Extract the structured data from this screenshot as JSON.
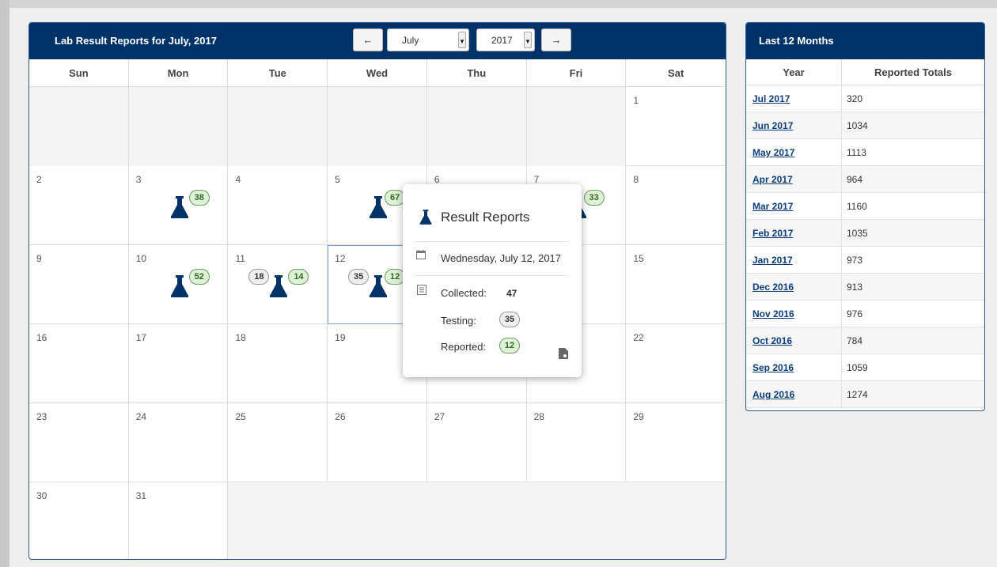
{
  "calendar": {
    "title": "Lab Result Reports for July, 2017",
    "month_select": "July",
    "year_select": "2017",
    "prev_label": "←",
    "next_label": "→",
    "weekdays": [
      "Sun",
      "Mon",
      "Tue",
      "Wed",
      "Thu",
      "Fri",
      "Sat"
    ],
    "days": {
      "d1": "1",
      "d2": "2",
      "d3": "3",
      "d4": "4",
      "d5": "5",
      "d6": "6",
      "d7": "7",
      "d8": "8",
      "d9": "9",
      "d10": "10",
      "d11": "11",
      "d12": "12",
      "d15": "15",
      "d16": "16",
      "d17": "17",
      "d18": "18",
      "d19": "19",
      "d22": "22",
      "d23": "23",
      "d24": "24",
      "d25": "25",
      "d26": "26",
      "d27": "27",
      "d28": "28",
      "d29": "29",
      "d30": "30",
      "d31": "31"
    },
    "badges": {
      "d3_reported": "38",
      "d5_reported": "67",
      "d7_reported": "33",
      "d10_reported": "52",
      "d11_testing": "18",
      "d11_reported": "14",
      "d12_testing": "35",
      "d12_reported": "12"
    }
  },
  "popover": {
    "title": "Result Reports",
    "date": "Wednesday, July 12, 2017",
    "collected_label": "Collected:",
    "collected_value": "47",
    "testing_label": "Testing:",
    "testing_value": "35",
    "reported_label": "Reported:",
    "reported_value": "12"
  },
  "summary": {
    "title": "Last 12 Months",
    "col_year": "Year",
    "col_totals": "Reported Totals",
    "rows": [
      {
        "month": "Jul 2017",
        "total": "320"
      },
      {
        "month": "Jun 2017",
        "total": "1034"
      },
      {
        "month": "May 2017",
        "total": "1113"
      },
      {
        "month": "Apr 2017",
        "total": "964"
      },
      {
        "month": "Mar 2017",
        "total": "1160"
      },
      {
        "month": "Feb 2017",
        "total": "1035"
      },
      {
        "month": "Jan 2017",
        "total": "973"
      },
      {
        "month": "Dec 2016",
        "total": "913"
      },
      {
        "month": "Nov 2016",
        "total": "976"
      },
      {
        "month": "Oct 2016",
        "total": "784"
      },
      {
        "month": "Sep 2016",
        "total": "1059"
      },
      {
        "month": "Aug 2016",
        "total": "1274"
      }
    ]
  },
  "colors": {
    "header_navy": "#013369",
    "badge_green": "#dff0d8",
    "link": "#0a3d7a"
  }
}
